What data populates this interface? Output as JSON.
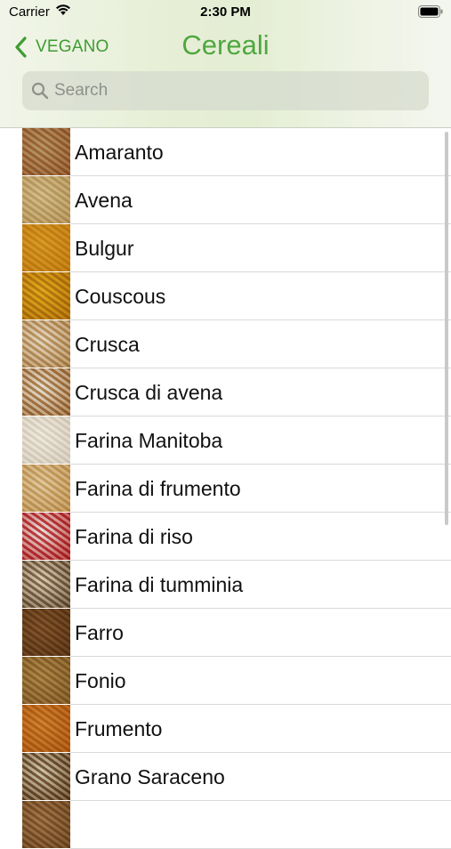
{
  "status_bar": {
    "carrier": "Carrier",
    "time": "2:30 PM"
  },
  "nav": {
    "back_label": "VEGANO",
    "title": "Cereali",
    "accent_color": "#4fa83f"
  },
  "search": {
    "placeholder": "Search",
    "value": ""
  },
  "list": {
    "items": [
      {
        "label": "Amaranto",
        "thumb": "amaranth-seeds-photo",
        "colors": [
          "#b8875a",
          "#d9c6a3"
        ]
      },
      {
        "label": "Avena",
        "thumb": "oat-grains-photo",
        "colors": [
          "#cfb889",
          "#e9ddbe"
        ]
      },
      {
        "label": "Bulgur",
        "thumb": "bulgur-photo",
        "colors": [
          "#d7a93a",
          "#ecc862"
        ]
      },
      {
        "label": "Couscous",
        "thumb": "couscous-bowl-photo",
        "colors": [
          "#c79a2a",
          "#f0d056"
        ]
      },
      {
        "label": "Crusca",
        "thumb": "bran-photo",
        "colors": [
          "#c8a877",
          "#f1eadf"
        ]
      },
      {
        "label": "Crusca di avena",
        "thumb": "oat-bran-photo",
        "colors": [
          "#b9905e",
          "#f3efe9"
        ]
      },
      {
        "label": "Farina Manitoba",
        "thumb": "manitoba-flour-photo",
        "colors": [
          "#e3ddd2",
          "#f7f4ee"
        ]
      },
      {
        "label": "Farina di frumento",
        "thumb": "wheat-flour-photo",
        "colors": [
          "#d5b57e",
          "#efe3cc"
        ]
      },
      {
        "label": "Farina di riso",
        "thumb": "rice-flour-bowl-photo",
        "colors": [
          "#c9484a",
          "#f3f1ee"
        ]
      },
      {
        "label": "Farina di tumminia",
        "thumb": "tumminia-flour-photo",
        "colors": [
          "#8f7b62",
          "#ede4d6"
        ]
      },
      {
        "label": "Farro",
        "thumb": "spelt-grains-photo",
        "colors": [
          "#8d6a44",
          "#b99669"
        ]
      },
      {
        "label": "Fonio",
        "thumb": "fonio-grains-photo",
        "colors": [
          "#aa8b57",
          "#d4bc8a"
        ]
      },
      {
        "label": "Frumento",
        "thumb": "wheat-field-photo",
        "colors": [
          "#c98a3a",
          "#e7b870"
        ]
      },
      {
        "label": "Grano Saraceno",
        "thumb": "buckwheat-plant-photo",
        "colors": [
          "#8a6b48",
          "#e6e2d4"
        ]
      },
      {
        "label": "",
        "thumb": "next-item-photo",
        "colors": [
          "#9c7a52",
          "#cdb08a"
        ]
      }
    ]
  }
}
